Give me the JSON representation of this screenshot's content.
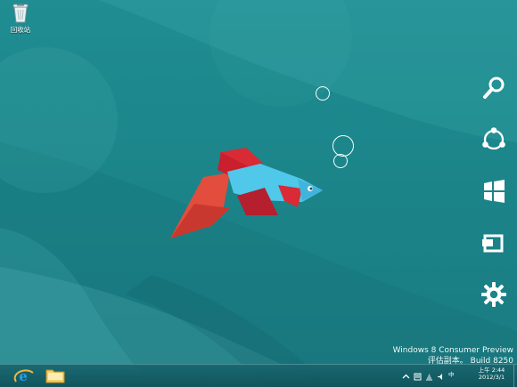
{
  "desktop": {
    "icons": [
      {
        "label": "回收站",
        "icon": "recycle-bin-icon"
      }
    ],
    "scene": {
      "subject": "betta-fish",
      "colors": {
        "background": "#1f8d92",
        "fish_blue": "#4fc8ea",
        "fish_red": "#c91f2e",
        "fin_orange": "#e5513e",
        "bubble": "#f4ffff"
      }
    }
  },
  "charms": [
    {
      "name": "search",
      "icon": "search-icon"
    },
    {
      "name": "share",
      "icon": "share-icon"
    },
    {
      "name": "start",
      "icon": "windows-logo-icon"
    },
    {
      "name": "devices",
      "icon": "devices-icon"
    },
    {
      "name": "settings",
      "icon": "gear-icon"
    }
  ],
  "watermark": {
    "line1": "Windows 8 Consumer Preview",
    "line2": "评估副本。 Build 8250"
  },
  "taskbar": {
    "pinned": [
      {
        "name": "internet-explorer",
        "icon": "internet-explorer-icon"
      },
      {
        "name": "file-explorer",
        "icon": "folder-icon"
      }
    ],
    "tray": {
      "input_method": "中",
      "time": "上午 2:44",
      "date": "2012/3/1"
    }
  }
}
